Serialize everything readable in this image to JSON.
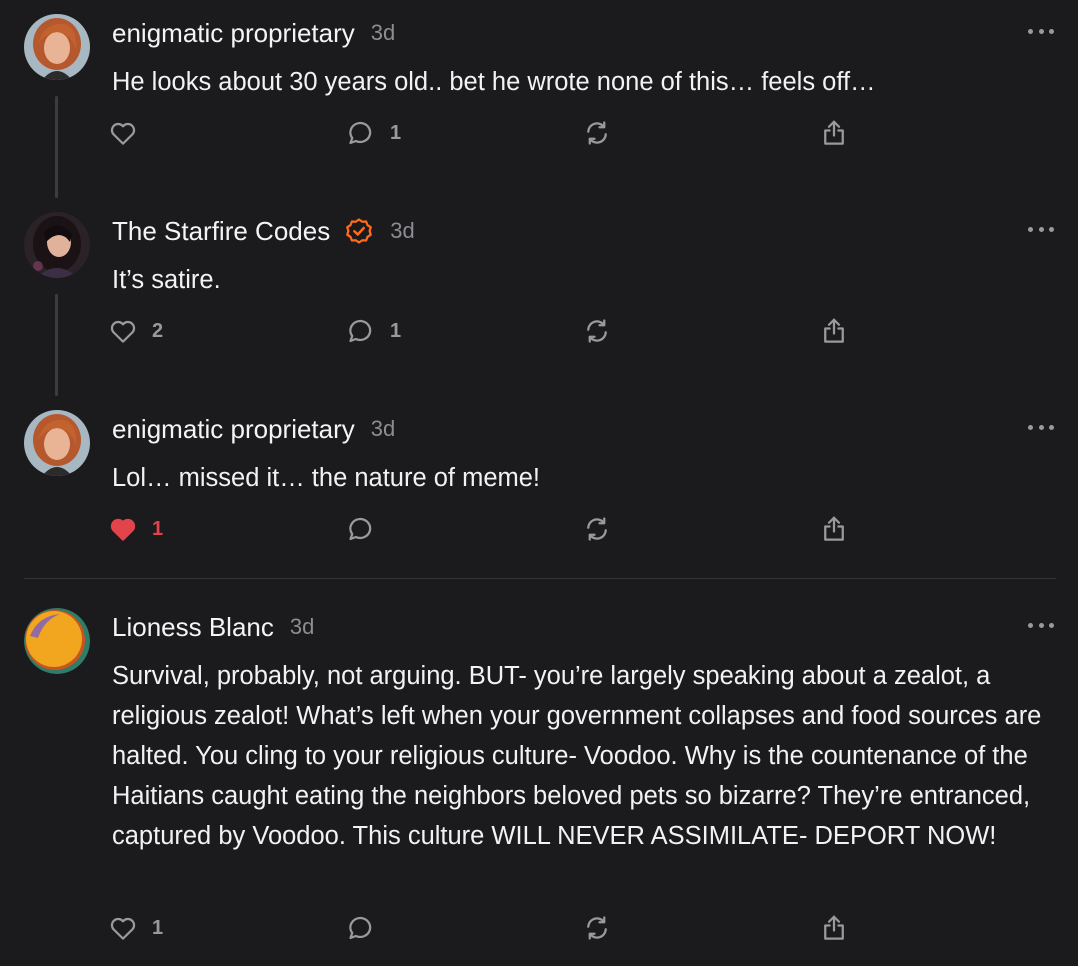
{
  "colors": {
    "background": "#1b1b1d",
    "verified": "#ff6b1a",
    "liked": "#e3434b",
    "muted": "#8d8d92"
  },
  "comments": [
    {
      "author": "enigmatic proprietary",
      "time": "3d",
      "verified": false,
      "text": "He looks about 30 years old.. bet he wrote none of this… feels off…",
      "likes": "",
      "replies": "1",
      "liked": false,
      "icons": [
        "heart-icon",
        "comment-icon",
        "restack-icon",
        "share-icon",
        "more-icon"
      ]
    },
    {
      "author": "The Starfire Codes",
      "time": "3d",
      "verified": true,
      "text": "It’s satire.",
      "likes": "2",
      "replies": "1",
      "liked": false
    },
    {
      "author": "enigmatic proprietary",
      "time": "3d",
      "verified": false,
      "text": "Lol… missed it… the nature of meme!",
      "likes": "1",
      "replies": "",
      "liked": true
    },
    {
      "author": "Lioness Blanc",
      "time": "3d",
      "verified": false,
      "text": "Survival, probably, not arguing. BUT- you’re largely speaking about a zealot, a religious zealot! What’s left when your government collapses and food sources are halted. You cling to your religious culture- Voodoo. Why is the countenance of the Haitians caught eating the neighbors beloved pets so bizarre? They’re entranced, captured by Voodoo. This culture WILL NEVER ASSIMILATE- DEPORT NOW!",
      "likes": "1",
      "replies": "",
      "liked": false
    }
  ]
}
